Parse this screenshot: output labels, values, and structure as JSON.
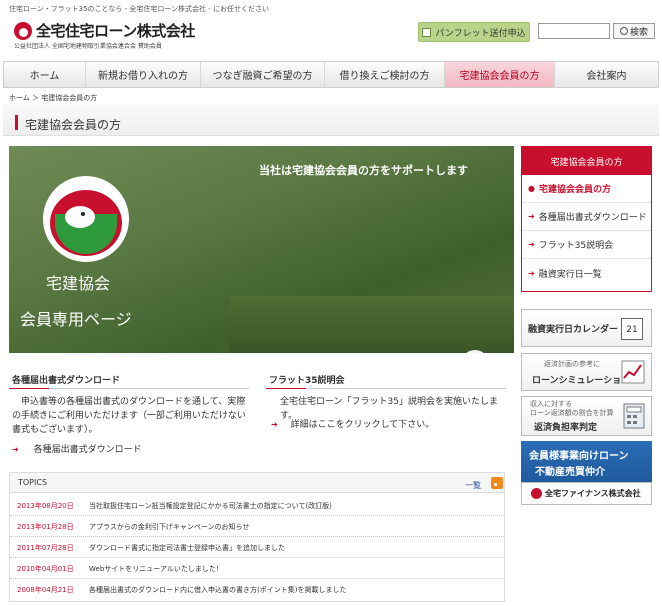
{
  "header": {
    "tagline": "住宅ローン・フラット35のことなら - 全宅住宅ローン株式会社 - にお任せください",
    "logo_text": "全宅住宅ローン株式会社",
    "logo_sub": "公益社団法人 全国宅地建物取引業協会連合会 賛助会員",
    "pamphlet_label": "パンフレット送付申込",
    "search_placeholder": "",
    "search_label": "検索"
  },
  "nav": [
    {
      "label": "ホーム"
    },
    {
      "label": "新規お借り入れの方"
    },
    {
      "label": "つなぎ融資ご希望の方"
    },
    {
      "label": "借り換えご検討の方"
    },
    {
      "label": "宅建協会会員の方"
    },
    {
      "label": "会社案内"
    }
  ],
  "breadcrumb": {
    "home": "ホーム",
    "sep": "＞",
    "current": "宅建協会会員の方"
  },
  "page_title": "宅建協会会員の方",
  "hero": {
    "headline": "当社は宅建協会会員の方をサポートします",
    "badge_text": "REAL PARTNER",
    "line1": "宅建協会",
    "line2": "会員専用ページ"
  },
  "sidebar": {
    "head": "宅建協会会員の方",
    "items": [
      {
        "label": "宅建協会会員の方"
      },
      {
        "label": "各種届出書式ダウンロード"
      },
      {
        "label": "フラット35説明会"
      },
      {
        "label": "融資実行日一覧"
      }
    ]
  },
  "banners": {
    "calendar": {
      "title": "融資実行日カレンダー",
      "icon": "21"
    },
    "sim": {
      "small": "返済計画の参考に",
      "big": "ローンシミュレーション"
    },
    "ratio": {
      "small1": "収入に対する",
      "small2": "ローン返済額の割合を計算",
      "big": "返済負担率判定"
    },
    "finance": {
      "line1": "会員様事業向けローン",
      "line2": "不動産売買仲介",
      "company": "全宅ファイナンス株式会社"
    }
  },
  "download": {
    "title": "各種届出書式ダウンロード",
    "text": "申込書等の各種届出書式のダウンロードを通して、実際の手続きにご利用いただけます（一部ご利用いただけない書式もございます）。",
    "link": "各種届出書式ダウンロード"
  },
  "flat35": {
    "title": "フラット35説明会",
    "text": "全宅住宅ローン「フラット35」説明会を実施いたします。",
    "link": "詳細はここをクリックして下さい。"
  },
  "topics": {
    "title": "TOPICS",
    "more": "一覧",
    "items": [
      {
        "date": "2013年08月20日",
        "text": "当社取扱住宅ローン抵当権設定登記にかかる司法書士の指定について(改訂版)"
      },
      {
        "date": "2013年01月28日",
        "text": "アプラスからの金利引下げキャンペーンのお知らせ"
      },
      {
        "date": "2011年07月28日",
        "text": "ダウンロード書式に指定司法書士登録申込書」を追加しました"
      },
      {
        "date": "2010年04月01日",
        "text": "Webサイトをリニューアルいたしました！"
      },
      {
        "date": "2008年04月21日",
        "text": "各種届出書式のダウンロード内に借入申込書の書き方(ポイント集)を掲載しました"
      }
    ]
  },
  "colors": {
    "accent": "#c8102e",
    "nav_active": "#f2b8c2",
    "pamphlet": "#b9d48a",
    "banner_blue": "#2b6db6"
  }
}
